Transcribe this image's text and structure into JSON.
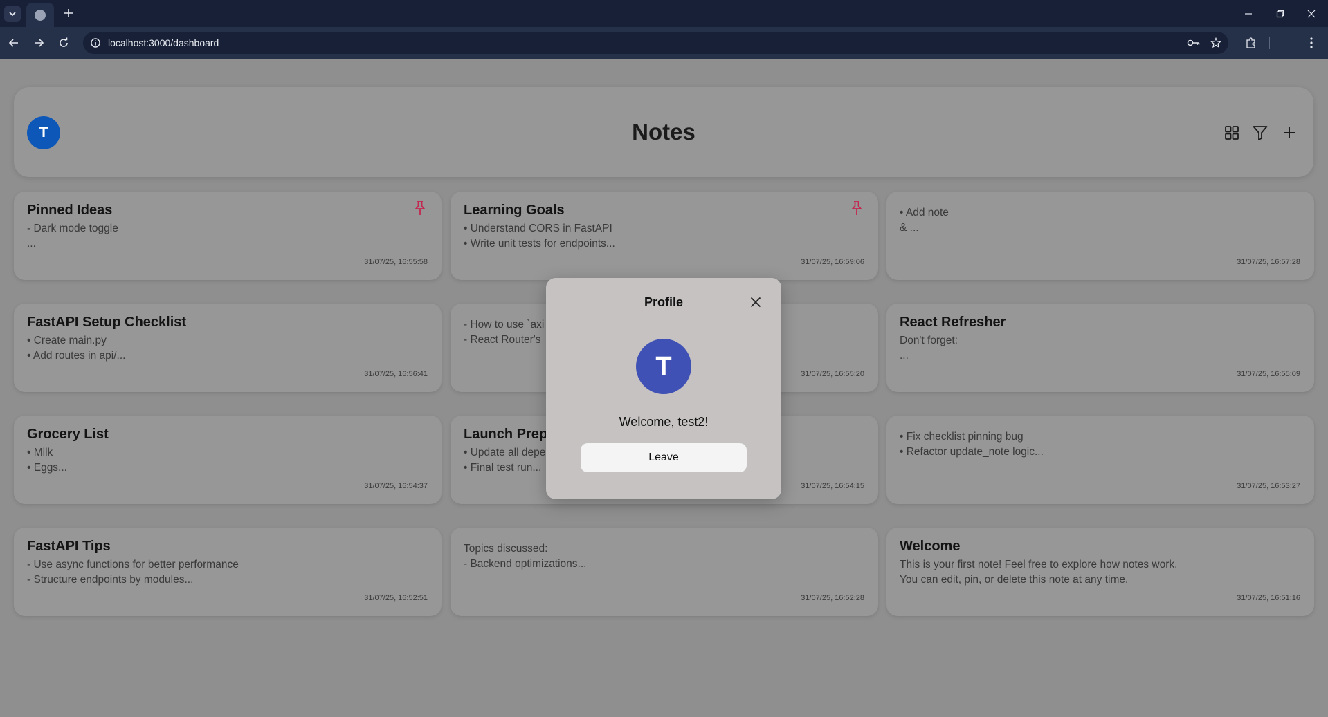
{
  "browser": {
    "url": "localhost:3000/dashboard"
  },
  "header": {
    "avatar_initial": "T",
    "title": "Notes",
    "icons": [
      "grid-view-icon",
      "filter-icon",
      "plus-icon"
    ]
  },
  "notes": [
    {
      "title": "Pinned Ideas",
      "lines": [
        "- Dark mode toggle",
        "..."
      ],
      "date": "31/07/25, 16:55:58",
      "pinned": true
    },
    {
      "title": "Learning Goals",
      "lines": [
        "• Understand CORS in FastAPI",
        "• Write unit tests for endpoints..."
      ],
      "date": "31/07/25, 16:59:06",
      "pinned": true
    },
    {
      "title": "",
      "lines": [
        "• Add note",
        "& ..."
      ],
      "date": "31/07/25, 16:57:28",
      "pinned": false
    },
    {
      "title": "FastAPI Setup Checklist",
      "lines": [
        "• Create main.py",
        "• Add routes in api/..."
      ],
      "date": "31/07/25, 16:56:41",
      "pinned": false
    },
    {
      "title": "",
      "lines": [
        "- How to use `axi",
        "- React Router's"
      ],
      "date": "31/07/25, 16:55:20",
      "pinned": false
    },
    {
      "title": "React Refresher",
      "lines": [
        "Don't forget:",
        "..."
      ],
      "date": "31/07/25, 16:55:09",
      "pinned": false
    },
    {
      "title": "Grocery List",
      "lines": [
        "• Milk",
        "• Eggs..."
      ],
      "date": "31/07/25, 16:54:37",
      "pinned": false
    },
    {
      "title": "Launch Prep",
      "lines": [
        "• Update all depe",
        "• Final test run..."
      ],
      "date": "31/07/25, 16:54:15",
      "pinned": false
    },
    {
      "title": "",
      "lines": [
        "• Fix checklist pinning bug",
        "• Refactor update_note logic..."
      ],
      "date": "31/07/25, 16:53:27",
      "pinned": false
    },
    {
      "title": "FastAPI Tips",
      "lines": [
        "- Use async functions for better performance",
        "- Structure endpoints by modules..."
      ],
      "date": "31/07/25, 16:52:51",
      "pinned": false
    },
    {
      "title": "",
      "lines": [
        "Topics discussed:",
        "- Backend optimizations..."
      ],
      "date": "31/07/25, 16:52:28",
      "pinned": false
    },
    {
      "title": "Welcome",
      "lines": [
        "This is your first note! Feel free to explore how notes work.",
        "You can edit, pin, or delete this note at any time."
      ],
      "date": "31/07/25, 16:51:16",
      "pinned": false
    }
  ],
  "modal": {
    "title": "Profile",
    "avatar_initial": "T",
    "welcome": "Welcome, test2!",
    "leave_label": "Leave"
  },
  "colors": {
    "avatar_small": "#0d57b8",
    "avatar_large": "#3f51b5",
    "pin": "#c4264f"
  }
}
